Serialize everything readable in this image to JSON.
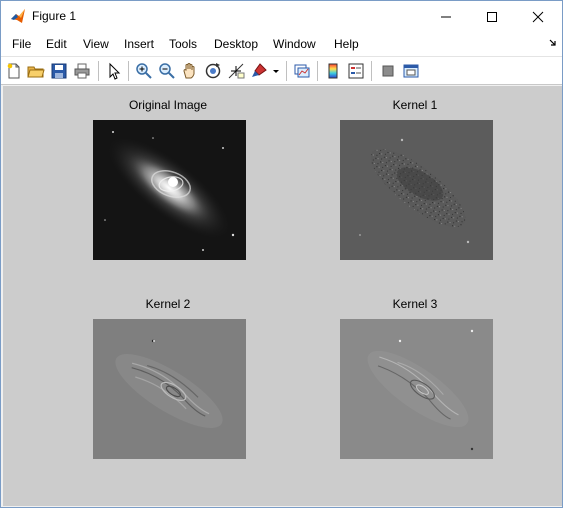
{
  "window": {
    "title": "Figure 1",
    "icon": "matlab-logo-icon"
  },
  "menu": {
    "items": [
      "File",
      "Edit",
      "View",
      "Insert",
      "Tools",
      "Desktop",
      "Window",
      "Help"
    ]
  },
  "toolbar": {
    "icons": [
      "new-figure-icon",
      "open-file-icon",
      "save-icon",
      "print-icon",
      "pointer-icon",
      "zoom-in-icon",
      "zoom-out-icon",
      "pan-icon",
      "rotate-3d-icon",
      "data-cursor-icon",
      "brush-icon",
      "link-plot-icon",
      "colorbar-icon",
      "legend-icon",
      "hide-plot-tools-icon",
      "show-plot-tools-icon"
    ]
  },
  "figure": {
    "background": "#cccccc",
    "subplots": [
      {
        "title": "Original Image"
      },
      {
        "title": "Kernel 1"
      },
      {
        "title": "Kernel 2"
      },
      {
        "title": "Kernel 3"
      }
    ]
  }
}
